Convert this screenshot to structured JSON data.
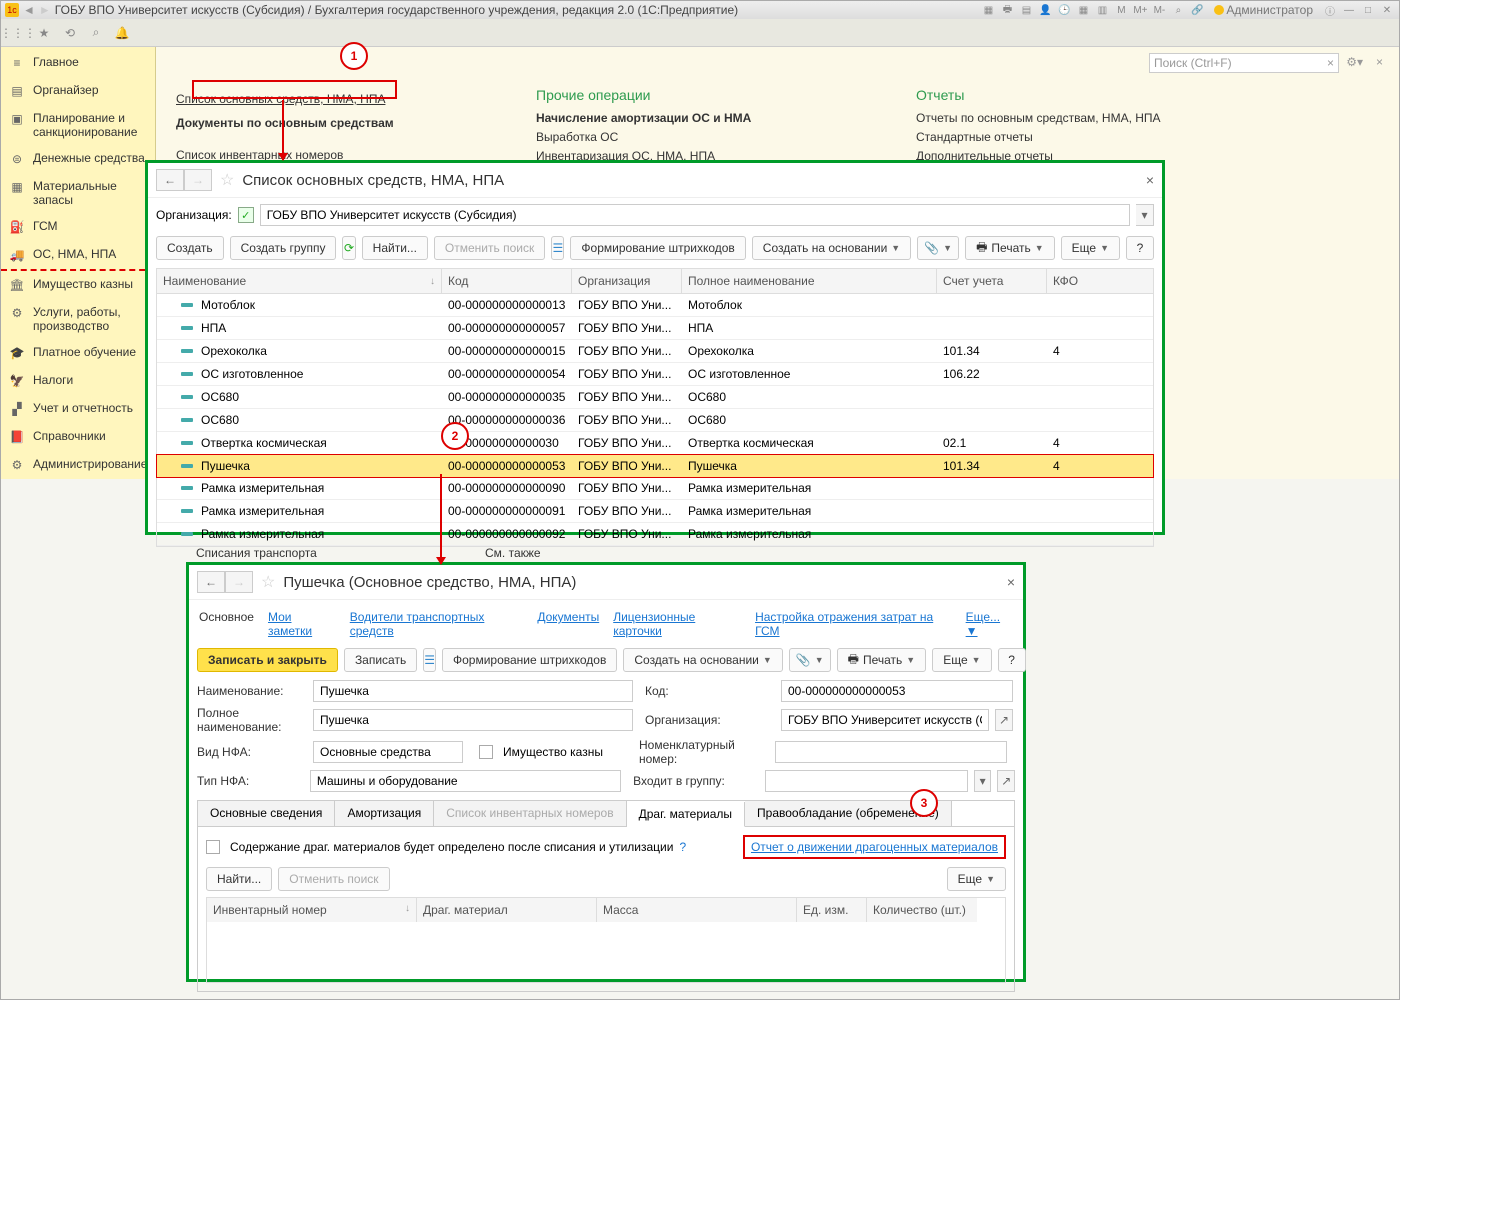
{
  "titlebar": {
    "title": "ГОБУ ВПО Университет искусств (Субсидия) / Бухгалтерия государственного учреждения, редакция 2.0  (1С:Предприятие)",
    "user": "Администратор"
  },
  "search": {
    "placeholder": "Поиск (Ctrl+F)"
  },
  "sidebar": {
    "items": [
      {
        "label": "Главное"
      },
      {
        "label": "Органайзер"
      },
      {
        "label": "Планирование и санкционирование"
      },
      {
        "label": "Денежные средства"
      },
      {
        "label": "Материальные запасы"
      },
      {
        "label": "ГСМ"
      },
      {
        "label": "ОС, НМА, НПА"
      },
      {
        "label": "Имущество казны"
      },
      {
        "label": "Услуги, работы, производство"
      },
      {
        "label": "Платное обучение"
      },
      {
        "label": "Налоги"
      },
      {
        "label": "Учет и отчетность"
      },
      {
        "label": "Справочники"
      },
      {
        "label": "Администрирование"
      }
    ]
  },
  "content": {
    "col1_link": "Список основных средств, НМА, НПА",
    "col1_head": "Документы по основным средствам",
    "col1_item1": "Список инвентарных номеров",
    "col2_head": "Прочие операции",
    "col2_items": [
      "Начисление амортизации ОС и НМА",
      "Выработка ОС",
      "Инвентаризация ОС, НМА, НПА"
    ],
    "col3_head": "Отчеты",
    "col3_items": [
      "Отчеты по основным средствам, НМА, НПА",
      "Стандартные отчеты",
      "Дополнительные отчеты"
    ]
  },
  "bottom": {
    "l1": "Списания транспорта",
    "l2": "См. также"
  },
  "callouts": {
    "c1": "1",
    "c2": "2",
    "c3": "3"
  },
  "panel1": {
    "title": "Список основных средств, НМА, НПА",
    "org_label": "Организация:",
    "org_value": "ГОБУ ВПО Университет искусств (Субсидия)",
    "buttons": {
      "create": "Создать",
      "create_group": "Создать группу",
      "find": "Найти...",
      "cancel": "Отменить поиск",
      "barcode": "Формирование штрихкодов",
      "create_based": "Создать на основании",
      "print": "Печать",
      "more": "Еще",
      "help": "?"
    },
    "columns": [
      "Наименование",
      "Код",
      "Организация",
      "Полное наименование",
      "Счет учета",
      "КФО"
    ],
    "rows": [
      {
        "name": "Мотоблок",
        "code": "00-000000000000013",
        "org": "ГОБУ ВПО Уни...",
        "full": "Мотоблок",
        "acct": "",
        "kfo": ""
      },
      {
        "name": "НПА",
        "code": "00-000000000000057",
        "org": "ГОБУ ВПО Уни...",
        "full": "НПА",
        "acct": "",
        "kfo": ""
      },
      {
        "name": "Орехоколка",
        "code": "00-000000000000015",
        "org": "ГОБУ ВПО Уни...",
        "full": "Орехоколка",
        "acct": "101.34",
        "kfo": "4"
      },
      {
        "name": "ОС изготовленное",
        "code": "00-000000000000054",
        "org": "ГОБУ ВПО Уни...",
        "full": "ОС изготовленное",
        "acct": "106.22",
        "kfo": ""
      },
      {
        "name": "ОС680",
        "code": "00-000000000000035",
        "org": "ГОБУ ВПО Уни...",
        "full": "ОС680",
        "acct": "",
        "kfo": ""
      },
      {
        "name": "ОС680",
        "code": "00-000000000000036",
        "org": "ГОБУ ВПО Уни...",
        "full": "ОС680",
        "acct": "",
        "kfo": ""
      },
      {
        "name": "Отвертка космическая",
        "code": "0-000000000000030",
        "org": "ГОБУ ВПО Уни...",
        "full": "Отвертка космическая",
        "acct": "02.1",
        "kfo": "4"
      },
      {
        "name": "Пушечка",
        "code": "00-000000000000053",
        "org": "ГОБУ ВПО Уни...",
        "full": "Пушечка",
        "acct": "101.34",
        "kfo": "4",
        "selected": true
      },
      {
        "name": "Рамка измерительная",
        "code": "00-000000000000090",
        "org": "ГОБУ ВПО Уни...",
        "full": "Рамка измерительная",
        "acct": "",
        "kfo": ""
      },
      {
        "name": "Рамка измерительная",
        "code": "00-000000000000091",
        "org": "ГОБУ ВПО Уни...",
        "full": "Рамка измерительная",
        "acct": "",
        "kfo": ""
      },
      {
        "name": "Рамка измерительная",
        "code": "00-000000000000092",
        "org": "ГОБУ ВПО Уни...",
        "full": "Рамка измерительная",
        "acct": "",
        "kfo": ""
      }
    ]
  },
  "panel2": {
    "title": "Пушечка (Основное средство, НМА, НПА)",
    "tabs": [
      "Основное",
      "Мои заметки",
      "Водители транспортных средств",
      "Документы",
      "Лицензионные карточки",
      "Настройка отражения затрат на ГСМ",
      "Еще..."
    ],
    "buttons": {
      "save_close": "Записать и закрыть",
      "save": "Записать",
      "barcode": "Формирование штрихкодов",
      "create_based": "Создать на основании",
      "print": "Печать",
      "more": "Еще",
      "help": "?"
    },
    "labels": {
      "name": "Наименование:",
      "code": "Код:",
      "full": "Полное наименование:",
      "org": "Организация:",
      "vid": "Вид НФА:",
      "kazna": "Имущество казны",
      "nomen": "Номенклатурный номер:",
      "type": "Тип НФА:",
      "group": "Входит в группу:"
    },
    "values": {
      "name": "Пушечка",
      "code": "00-000000000000053",
      "full": "Пушечка",
      "org": "ГОБУ ВПО Университет искусств (Субсидия)",
      "vid": "Основные средства",
      "type": "Машины и оборудование",
      "nomen": "",
      "group": ""
    },
    "subtabs": [
      "Основные сведения",
      "Амортизация",
      "Список инвентарных номеров",
      "Драг. материалы",
      "Правообладание (обременение)"
    ],
    "check_label": "Содержание драг. материалов будет определено после списания и утилизации",
    "report_link": "Отчет о движении драгоценных материалов",
    "tbl2_cols": [
      "Инвентарный номер",
      "Драг. материал",
      "Масса",
      "Ед. изм.",
      "Количество (шт.)"
    ],
    "find": "Найти...",
    "cancel": "Отменить поиск",
    "more": "Еще"
  }
}
